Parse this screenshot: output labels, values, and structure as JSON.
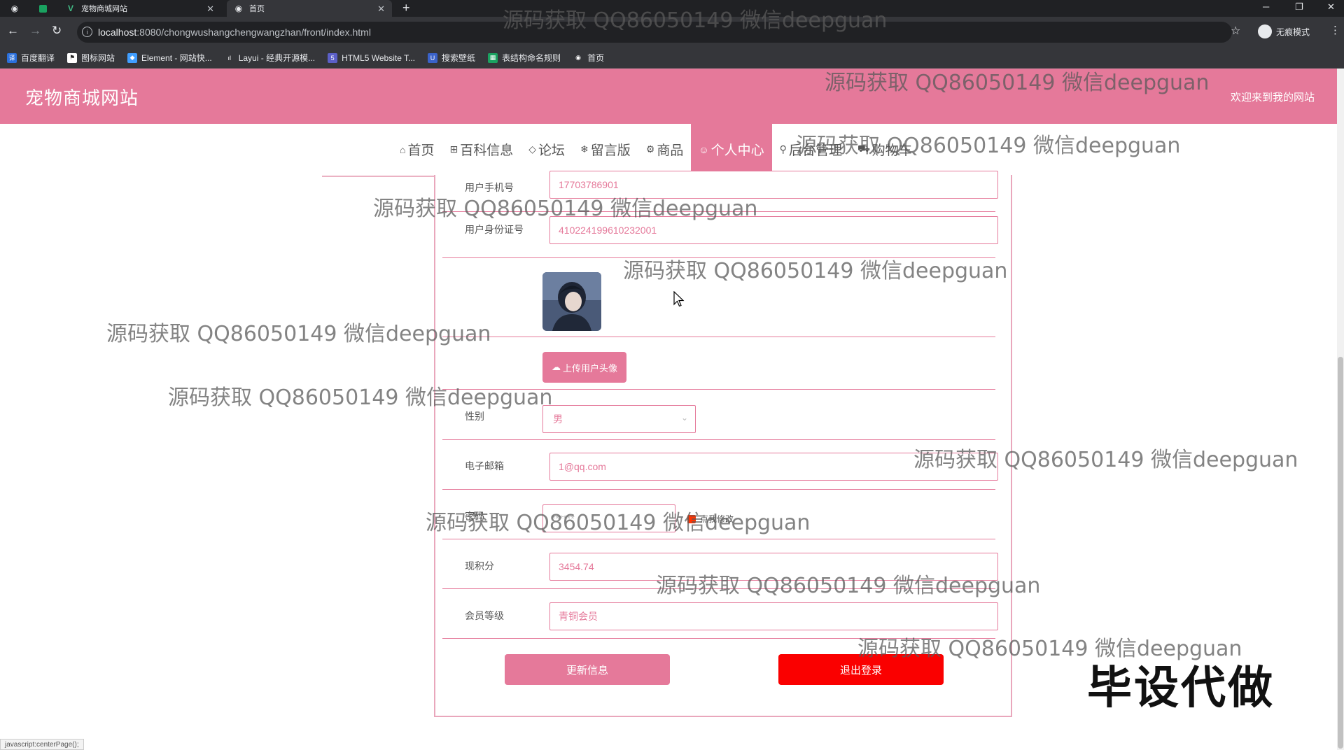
{
  "browser": {
    "tabs": [
      {
        "title": "宠物商城网站",
        "icon": "vue-logo-icon"
      },
      {
        "title": "首页",
        "icon": "globe-icon"
      }
    ],
    "url_host": "localhost",
    "url_path": ":8080/chongwushangchengwangzhan/front/index.html",
    "profile_label": "无痕模式",
    "bookmarks": [
      "百度翻译",
      "图标网站",
      "Element - 网站快...",
      "Layui - 经典开源模...",
      "HTML5 Website T...",
      "搜索壁纸",
      "表结构命名规则",
      "首页"
    ],
    "status_text": "javascript:centerPage();"
  },
  "header": {
    "site_title": "宠物商城网站",
    "welcome": "欢迎来到我的网站"
  },
  "nav": [
    {
      "label": "首页",
      "icon": "home-icon"
    },
    {
      "label": "百科信息",
      "icon": "grid-icon"
    },
    {
      "label": "论坛",
      "icon": "tag-icon"
    },
    {
      "label": "留言版",
      "icon": "snowflake-icon"
    },
    {
      "label": "商品",
      "icon": "gear-icon"
    },
    {
      "label": "个人中心",
      "icon": "user-icon",
      "active": true
    },
    {
      "label": "后台管理",
      "icon": "link-icon"
    },
    {
      "label": "购物车",
      "icon": "cart-icon"
    }
  ],
  "form": {
    "phone_label": "用户手机号",
    "phone_value": "17703786901",
    "idcard_label": "用户身份证号",
    "idcard_value": "410224199610232001",
    "upload_label": "上传用户头像",
    "gender_label": "性别",
    "gender_value": "男",
    "email_label": "电子邮箱",
    "email_value": "1@qq.com",
    "password_label": "密码",
    "password_value": "******",
    "password_link": "点我修改",
    "points_label": "现积分",
    "points_value": "3454.74",
    "level_label": "会员等级",
    "level_value": "青铜会员",
    "update_button": "更新信息",
    "logout_button": "退出登录"
  },
  "watermark_text": "源码获取 QQ86050149 微信deepguan",
  "overlay_text": "毕设代做",
  "colors": {
    "brand_pink": "#e5799a",
    "logout_red": "#fa0000"
  }
}
